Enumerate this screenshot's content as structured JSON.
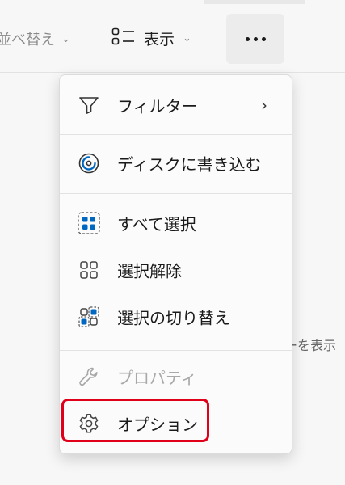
{
  "toolbar": {
    "sort_label": "並べ替え",
    "view_label": "表示",
    "view_icon": "view-layout-icon",
    "more_icon": "more-horizontal-icon"
  },
  "menu": {
    "filter": {
      "label": "フィルター",
      "icon": "filter-icon",
      "has_submenu": true
    },
    "burn": {
      "label": "ディスクに書き込む",
      "icon": "disc-burn-icon"
    },
    "select_all": {
      "label": "すべて選択",
      "icon": "select-all-icon"
    },
    "select_none": {
      "label": "選択解除",
      "icon": "select-none-icon"
    },
    "invert": {
      "label": "選択の切り替え",
      "icon": "invert-selection-icon"
    },
    "properties": {
      "label": "プロパティ",
      "icon": "wrench-icon",
      "disabled": true
    },
    "options": {
      "label": "オプション",
      "icon": "gear-icon"
    }
  },
  "background": {
    "partial_text": "ーを表示"
  },
  "colors": {
    "accent": "#0067c0",
    "highlight": "#e0001a"
  }
}
